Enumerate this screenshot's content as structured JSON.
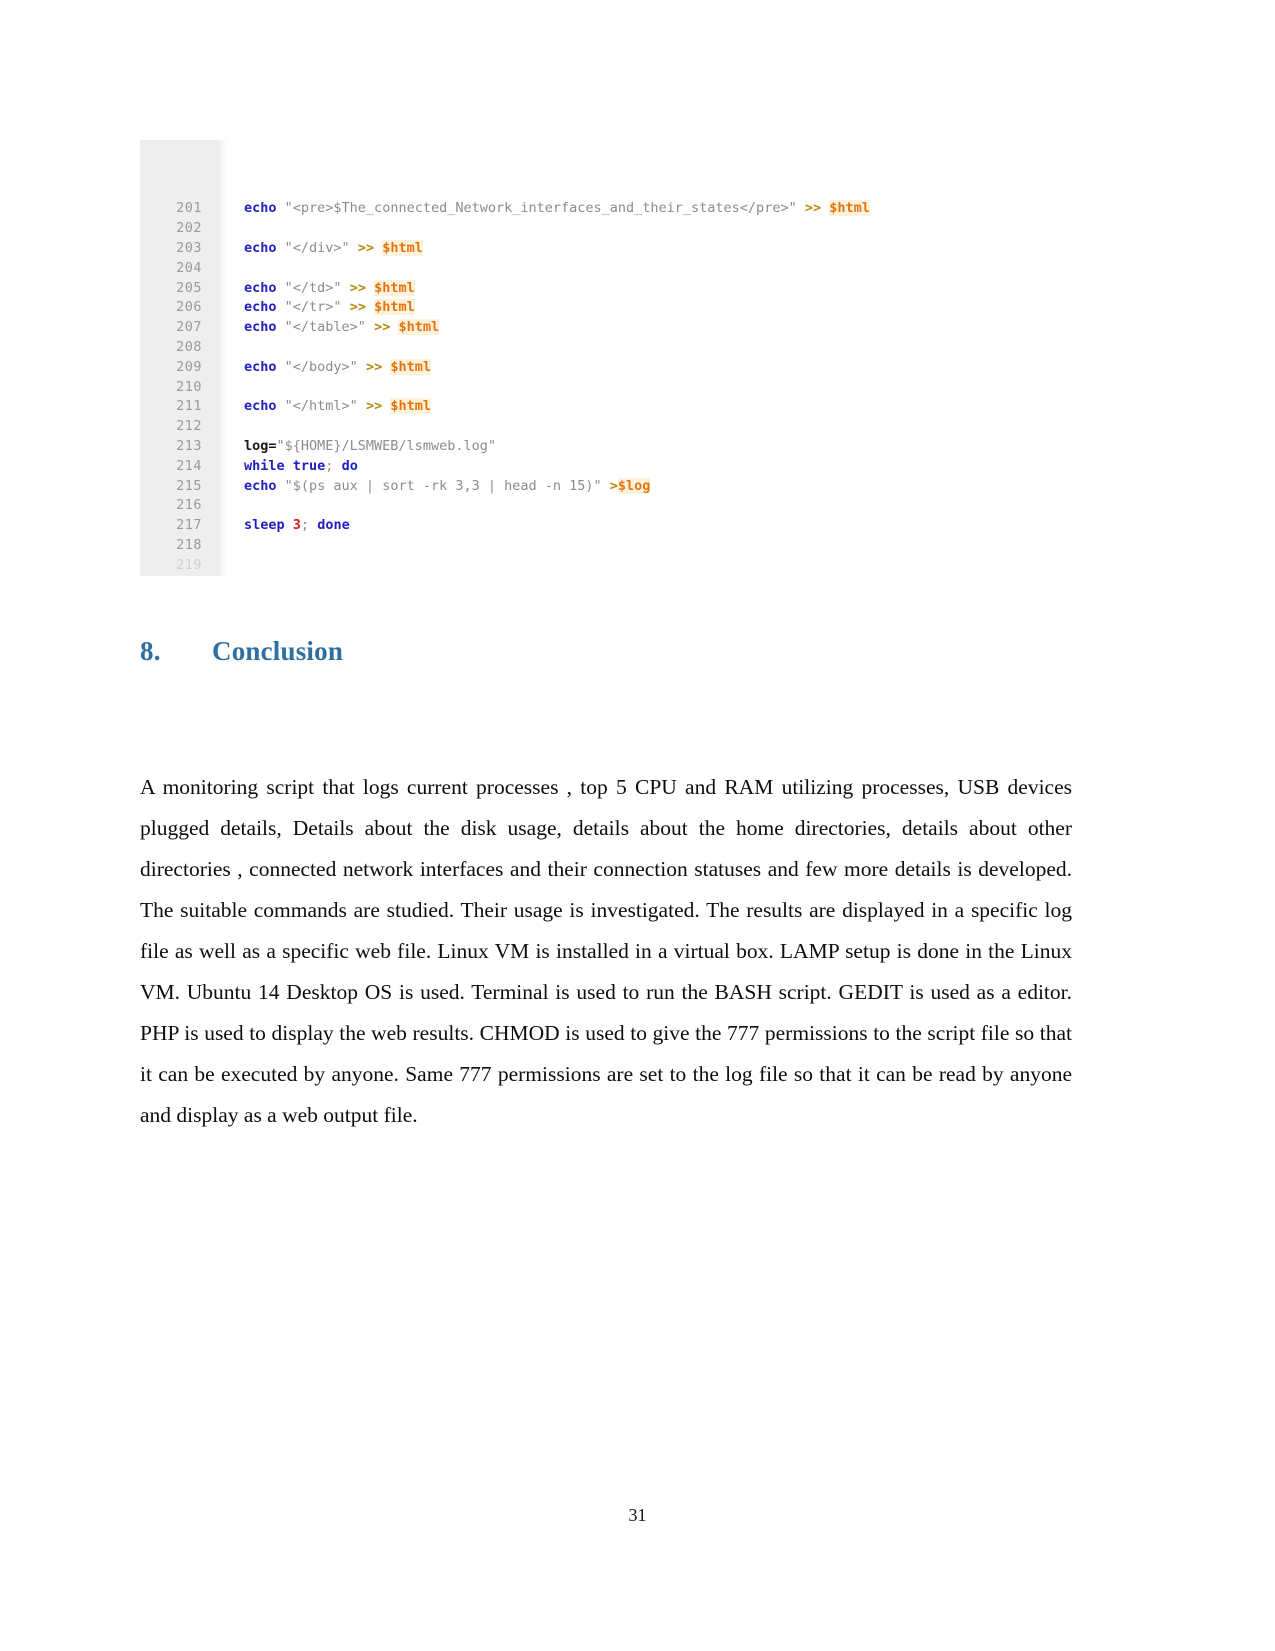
{
  "document": {
    "page_number": "31",
    "heading": {
      "number": "8.",
      "title": "Conclusion",
      "color": "#2f6fa0"
    },
    "paragraph": "A monitoring script that logs current processes , top 5 CPU and RAM utilizing processes, USB devices plugged details, Details about the disk usage, details about the home directories, details about other directories , connected network interfaces and their connection statuses and few more details is developed. The suitable commands are studied. Their usage is investigated. The results are displayed in a specific log file as well as a specific web file. Linux VM is installed in a virtual box. LAMP setup is done in the Linux VM. Ubuntu 14 Desktop OS is used. Terminal is used to run the BASH script. GEDIT is used as a editor. PHP is used to display the web results. CHMOD is used to give the 777 permissions to the script file so that it can be executed by anyone. Same 777 permissions are set to the log file so that it can be read by anyone and display as a web output file."
  },
  "code_figure": {
    "colors": {
      "gutter_background": "#eeeeee",
      "line_number": "#9a9a9a",
      "keyword": "#2020c0",
      "string": "#8c8c8c",
      "redirect_operator": "#b8860b",
      "variable": "#e8730c",
      "variable_highlight": "#fdf3dc",
      "number": "#d02020"
    },
    "lines": [
      {
        "no": "201",
        "tokens": [
          {
            "t": "echo",
            "c": "k"
          },
          {
            "t": " ",
            "c": "s"
          },
          {
            "t": "\"<pre>$The_connected_Network_interfaces_and_their_states</pre>\"",
            "c": "s"
          },
          {
            "t": " ",
            "c": "s"
          },
          {
            "t": ">>",
            "c": "op"
          },
          {
            "t": " ",
            "c": "s"
          },
          {
            "t": "$html",
            "c": "v"
          }
        ]
      },
      {
        "no": "202",
        "tokens": []
      },
      {
        "no": "203",
        "tokens": [
          {
            "t": "echo",
            "c": "k"
          },
          {
            "t": " ",
            "c": "s"
          },
          {
            "t": "\"</div>\"",
            "c": "s"
          },
          {
            "t": " ",
            "c": "s"
          },
          {
            "t": ">>",
            "c": "op"
          },
          {
            "t": " ",
            "c": "s"
          },
          {
            "t": "$html",
            "c": "v"
          }
        ]
      },
      {
        "no": "204",
        "tokens": []
      },
      {
        "no": "205",
        "tokens": [
          {
            "t": "echo",
            "c": "k"
          },
          {
            "t": " ",
            "c": "s"
          },
          {
            "t": "\"</td>\"",
            "c": "s"
          },
          {
            "t": " ",
            "c": "s"
          },
          {
            "t": ">>",
            "c": "op"
          },
          {
            "t": " ",
            "c": "s"
          },
          {
            "t": "$html",
            "c": "v"
          }
        ]
      },
      {
        "no": "206",
        "tokens": [
          {
            "t": "echo",
            "c": "k"
          },
          {
            "t": " ",
            "c": "s"
          },
          {
            "t": "\"</tr>\"",
            "c": "s"
          },
          {
            "t": " ",
            "c": "s"
          },
          {
            "t": ">>",
            "c": "op"
          },
          {
            "t": " ",
            "c": "s"
          },
          {
            "t": "$html",
            "c": "v"
          }
        ]
      },
      {
        "no": "207",
        "tokens": [
          {
            "t": "echo",
            "c": "k"
          },
          {
            "t": " ",
            "c": "s"
          },
          {
            "t": "\"</table>\"",
            "c": "s"
          },
          {
            "t": " ",
            "c": "s"
          },
          {
            "t": ">>",
            "c": "op"
          },
          {
            "t": " ",
            "c": "s"
          },
          {
            "t": "$html",
            "c": "v"
          }
        ]
      },
      {
        "no": "208",
        "tokens": []
      },
      {
        "no": "209",
        "tokens": [
          {
            "t": "echo",
            "c": "k"
          },
          {
            "t": " ",
            "c": "s"
          },
          {
            "t": "\"</body>\"",
            "c": "s"
          },
          {
            "t": " ",
            "c": "s"
          },
          {
            "t": ">>",
            "c": "op"
          },
          {
            "t": " ",
            "c": "s"
          },
          {
            "t": "$html",
            "c": "v"
          }
        ]
      },
      {
        "no": "210",
        "tokens": []
      },
      {
        "no": "211",
        "tokens": [
          {
            "t": "echo",
            "c": "k"
          },
          {
            "t": " ",
            "c": "s"
          },
          {
            "t": "\"</html>\"",
            "c": "s"
          },
          {
            "t": " ",
            "c": "s"
          },
          {
            "t": ">>",
            "c": "op"
          },
          {
            "t": " ",
            "c": "s"
          },
          {
            "t": "$html",
            "c": "v"
          }
        ]
      },
      {
        "no": "212",
        "tokens": []
      },
      {
        "no": "213",
        "tokens": [
          {
            "t": "log=",
            "c": "asg"
          },
          {
            "t": "\"${HOME}/LSMWEB/lsmweb.log\"",
            "c": "s"
          }
        ]
      },
      {
        "no": "214",
        "tokens": [
          {
            "t": "while",
            "c": "k"
          },
          {
            "t": " ",
            "c": "s"
          },
          {
            "t": "true",
            "c": "k"
          },
          {
            "t": ";",
            "c": "s"
          },
          {
            "t": " ",
            "c": "s"
          },
          {
            "t": "do",
            "c": "k"
          }
        ]
      },
      {
        "no": "215",
        "tokens": [
          {
            "t": "echo",
            "c": "k"
          },
          {
            "t": " ",
            "c": "s"
          },
          {
            "t": "\"$(ps aux | sort -rk 3,3 | head -n 15)\"",
            "c": "s"
          },
          {
            "t": " ",
            "c": "s"
          },
          {
            "t": ">",
            "c": "op"
          },
          {
            "t": "$log",
            "c": "v"
          }
        ]
      },
      {
        "no": "216",
        "tokens": []
      },
      {
        "no": "217",
        "tokens": [
          {
            "t": "sleep",
            "c": "k"
          },
          {
            "t": " ",
            "c": "s"
          },
          {
            "t": "3",
            "c": "n"
          },
          {
            "t": ";",
            "c": "s"
          },
          {
            "t": " ",
            "c": "s"
          },
          {
            "t": "done",
            "c": "k"
          }
        ]
      },
      {
        "no": "218",
        "tokens": []
      },
      {
        "no": "219",
        "tokens": [],
        "clipped": true
      }
    ]
  }
}
